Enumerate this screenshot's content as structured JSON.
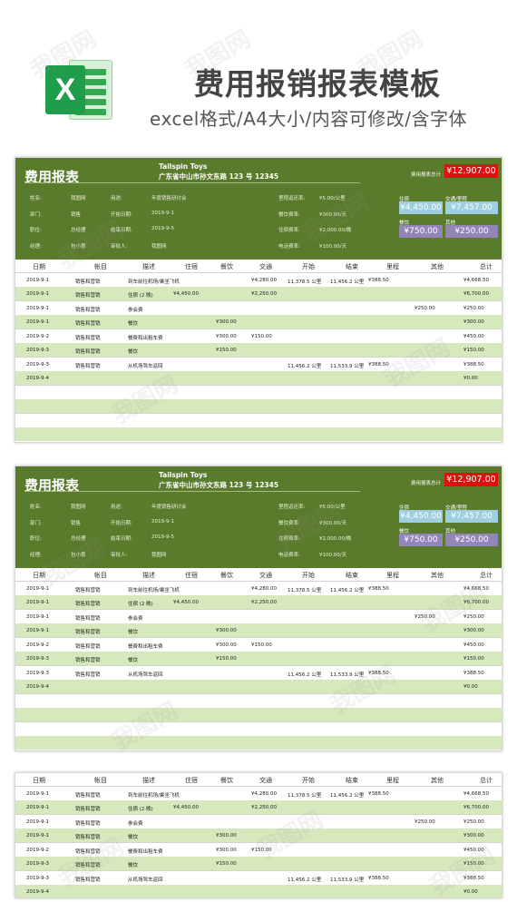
{
  "header": {
    "icon_label": "X",
    "title": "费用报销报表模板",
    "subtitle": "excel格式/A4大小/内容可修改/含字体"
  },
  "report": {
    "title": "费用报表",
    "company": "Tailspin Toys",
    "address": "广东省中山市孙文东路 123 号 12345",
    "total_label": "费用报表总计",
    "total": "¥12,907.00",
    "info": {
      "name_label": "姓名:",
      "name": "我图网",
      "dept_label": "部门:",
      "dept": "销售",
      "position_label": "职位:",
      "position": "总经理",
      "manager_label": "经理:",
      "manager": "包小惠",
      "purpose_label": "用途:",
      "purpose": "年度销售研讨会",
      "start_label": "开始日期:",
      "start": "2019-9-1",
      "end_label": "结束日期:",
      "end": "2019-9-5",
      "approver_label": "审批人:",
      "approver": "我图网",
      "mileage_label": "里程返还率:",
      "mileage": "¥5.00/公里",
      "meal_label": "餐饮费率:",
      "meal": "¥300.00/天",
      "lodging_label": "住宿费率:",
      "lodging": "¥2,000.00/晚",
      "phone_label": "电话费率:",
      "phone": "¥100.00/天"
    },
    "summary": {
      "lodging_label": "住宿",
      "lodging": "¥4,450.00",
      "transport_label": "交通/里程",
      "transport": "¥7,457.00",
      "meals_label": "餐饮",
      "meals": "¥750.00",
      "other_label": "其他",
      "other": "¥250.00"
    }
  },
  "columns": [
    "日期",
    "帐目",
    "描述",
    "住宿",
    "餐饮",
    "交通",
    "开始",
    "结束",
    "里程",
    "其他",
    "总计"
  ],
  "rows": [
    {
      "date": "2019-9-1",
      "account": "销售和营销",
      "desc": "到车前往机场/乘坐飞机",
      "lodging": "",
      "meal": "",
      "transport": "¥4,280.00",
      "start": "11,378.5 公里",
      "end": "11,456.2 公里",
      "mileage": "¥388.50",
      "other": "",
      "total": "¥4,668.50"
    },
    {
      "date": "2019-9-1",
      "account": "销售和营销",
      "desc": "住宿 (2 晚)",
      "lodging": "¥4,450.00",
      "meal": "",
      "transport": "¥2,250.00",
      "start": "",
      "end": "",
      "mileage": "",
      "other": "",
      "total": "¥6,700.00"
    },
    {
      "date": "2019-9-1",
      "account": "销售和营销",
      "desc": "参会费",
      "lodging": "",
      "meal": "",
      "transport": "",
      "start": "",
      "end": "",
      "mileage": "",
      "other": "¥250.00",
      "total": "¥250.00"
    },
    {
      "date": "2019-9-1",
      "account": "销售和营销",
      "desc": "餐饮",
      "lodging": "",
      "meal": "¥300.00",
      "transport": "",
      "start": "",
      "end": "",
      "mileage": "",
      "other": "",
      "total": "¥300.00"
    },
    {
      "date": "2019-9-2",
      "account": "销售和营销",
      "desc": "餐费和出租车费",
      "lodging": "",
      "meal": "¥300.00",
      "transport": "¥150.00",
      "start": "",
      "end": "",
      "mileage": "",
      "other": "",
      "total": "¥450.00"
    },
    {
      "date": "2019-9-3",
      "account": "销售和营销",
      "desc": "餐饮",
      "lodging": "",
      "meal": "¥150.00",
      "transport": "",
      "start": "",
      "end": "",
      "mileage": "",
      "other": "",
      "total": "¥150.00"
    },
    {
      "date": "2019-9-3",
      "account": "销售和营销",
      "desc": "从机场驾车返回",
      "lodging": "",
      "meal": "",
      "transport": "",
      "start": "11,456.2 公里",
      "end": "11,533.9 公里",
      "mileage": "¥388.50",
      "other": "",
      "total": "¥388.50"
    },
    {
      "date": "2019-9-4",
      "account": "",
      "desc": "",
      "lodging": "",
      "meal": "",
      "transport": "",
      "start": "",
      "end": "",
      "mileage": "",
      "other": "",
      "total": "¥0.00"
    }
  ],
  "watermark": "我图网"
}
